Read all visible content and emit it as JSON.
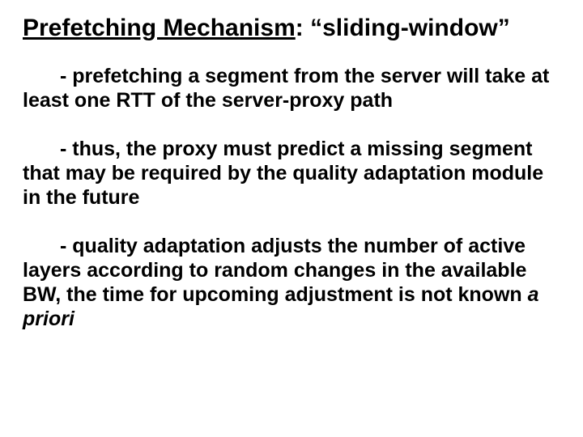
{
  "title": {
    "label": "Prefetching Mechanism",
    "colon": ":",
    "quoted": "“sliding-window”"
  },
  "bullets": {
    "b1": "- prefetching a segment from the server will take at least one RTT of the server-proxy path",
    "b2": "- thus, the proxy must predict a missing segment that may be required by the quality adaptation module in the future",
    "b3_part1": "- quality adaptation adjusts the number of active layers according to random changes in the available BW, the time for upcoming adjustment is not known ",
    "b3_italic": "a priori"
  }
}
